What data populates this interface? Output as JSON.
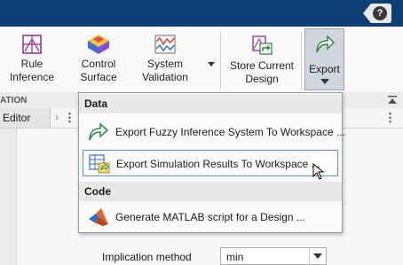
{
  "toolbar": {
    "rule_inference": "Rule\nInference",
    "control_surface": "Control\nSurface",
    "system_validation": "System\nValidation",
    "store_current_design": "Store Current\nDesign",
    "export": "Export"
  },
  "section_strip": {
    "label": "ATION"
  },
  "tabs": {
    "editor": "Editor"
  },
  "export_menu": {
    "sections": [
      {
        "header": "Data",
        "items": [
          "Export Fuzzy Inference System To Workspace ...",
          "Export Simulation Results To Workspace ..."
        ]
      },
      {
        "header": "Code",
        "items": [
          "Generate MATLAB script for a Design ..."
        ]
      }
    ]
  },
  "properties": {
    "implication_method_label": "Implication method",
    "implication_method_value": "min"
  },
  "colors": {
    "title_bar": "#0b3f73",
    "highlight_border": "#5b8fd0"
  }
}
